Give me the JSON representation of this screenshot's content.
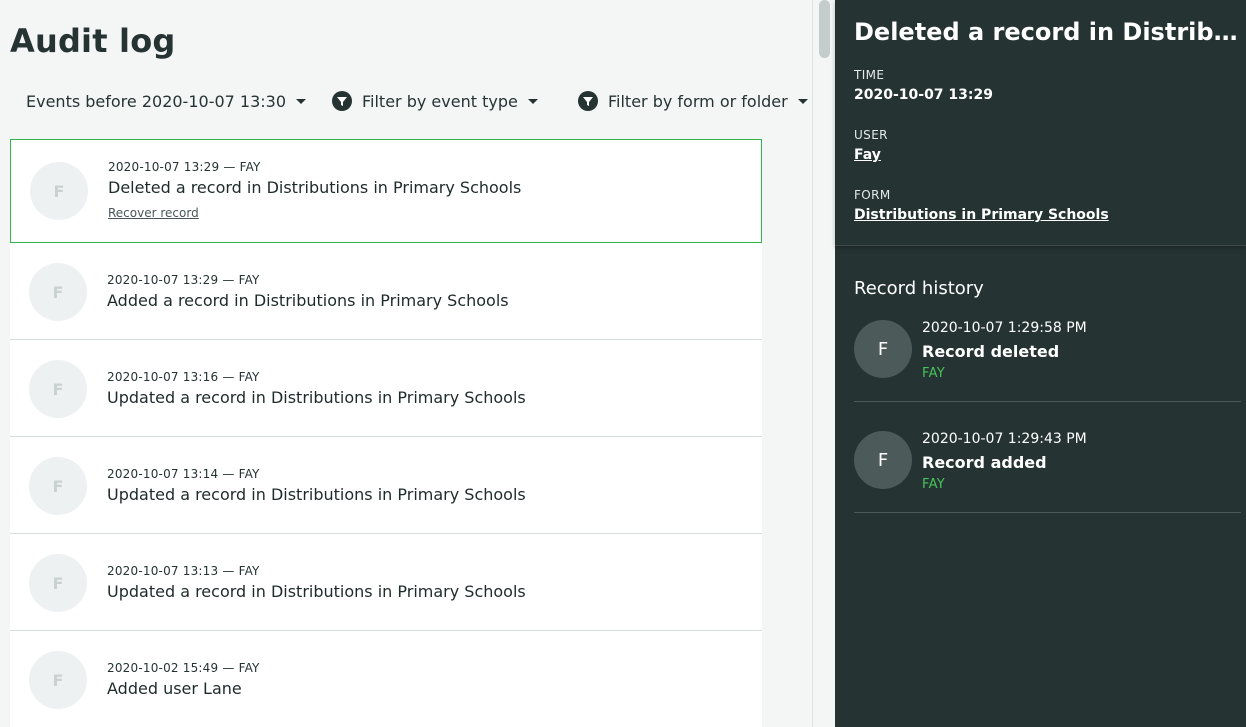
{
  "page": {
    "title": "Audit log"
  },
  "filters": {
    "date_label": "Events before 2020-10-07 13:30",
    "event_type_label": "Filter by event type",
    "form_label": "Filter by form or folder"
  },
  "events": [
    {
      "initial": "F",
      "meta": "2020-10-07 13:29 — FAY",
      "description": "Deleted a record in Distributions in Primary Schools",
      "link": "Recover record"
    },
    {
      "initial": "F",
      "meta": "2020-10-07 13:29 — FAY",
      "description": "Added a record in Distributions in Primary Schools"
    },
    {
      "initial": "F",
      "meta": "2020-10-07 13:16 — FAY",
      "description": "Updated a record in Distributions in Primary Schools"
    },
    {
      "initial": "F",
      "meta": "2020-10-07 13:14 — FAY",
      "description": "Updated a record in Distributions in Primary Schools"
    },
    {
      "initial": "F",
      "meta": "2020-10-07 13:13 — FAY",
      "description": "Updated a record in Distributions in Primary Schools"
    },
    {
      "initial": "F",
      "meta": "2020-10-02 15:49 — FAY",
      "description": "Added user Lane"
    }
  ],
  "detail": {
    "title": "Deleted a record in Distributions in Primary Schools",
    "time_label": "TIME",
    "time_value": "2020-10-07 13:29",
    "user_label": "USER",
    "user_value": "Fay",
    "form_label": "FORM",
    "form_value": "Distributions in Primary Schools",
    "history_title": "Record history",
    "history": [
      {
        "initial": "F",
        "time": "2020-10-07 1:29:58 PM",
        "action": "Record deleted",
        "user": "FAY"
      },
      {
        "initial": "F",
        "time": "2020-10-07 1:29:43 PM",
        "action": "Record added",
        "user": "FAY"
      }
    ]
  },
  "colors": {
    "accent_green": "#33b34a",
    "panel_bg": "#263333",
    "user_green": "#46c35a"
  },
  "icons": {
    "filter": "filter-funnel-icon",
    "caret": "caret-down-icon"
  }
}
